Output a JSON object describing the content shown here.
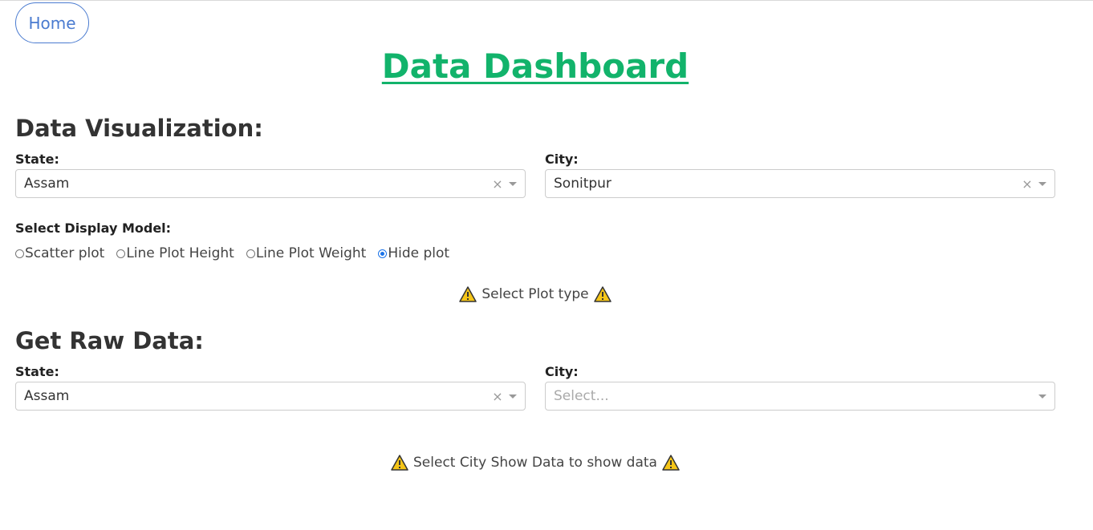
{
  "nav": {
    "home_label": "Home"
  },
  "page_title": "Data Dashboard",
  "visualization": {
    "heading": "Data Visualization:",
    "state_label": "State:",
    "state_value": "Assam",
    "city_label": "City:",
    "city_value": "Sonitpur",
    "display_model_label": "Select Display Model:",
    "display_options": [
      {
        "label": "Scatter plot",
        "checked": false
      },
      {
        "label": "Line Plot Height",
        "checked": false
      },
      {
        "label": "Line Plot Weight",
        "checked": false
      },
      {
        "label": "Hide plot",
        "checked": true
      }
    ],
    "notice": "Select Plot type"
  },
  "raw_data": {
    "heading": "Get Raw Data:",
    "state_label": "State:",
    "state_value": "Assam",
    "city_label": "City:",
    "city_placeholder": "Select...",
    "notice": "Select City Show Data to show data"
  },
  "icons": {
    "warning": "warning-icon",
    "clear": "clear-icon",
    "dropdown": "chevron-down-icon"
  },
  "colors": {
    "title": "#12b36b",
    "link": "#4a7bd0",
    "radio_selected": "#1a73e8",
    "warning_fill": "#f5c518"
  }
}
